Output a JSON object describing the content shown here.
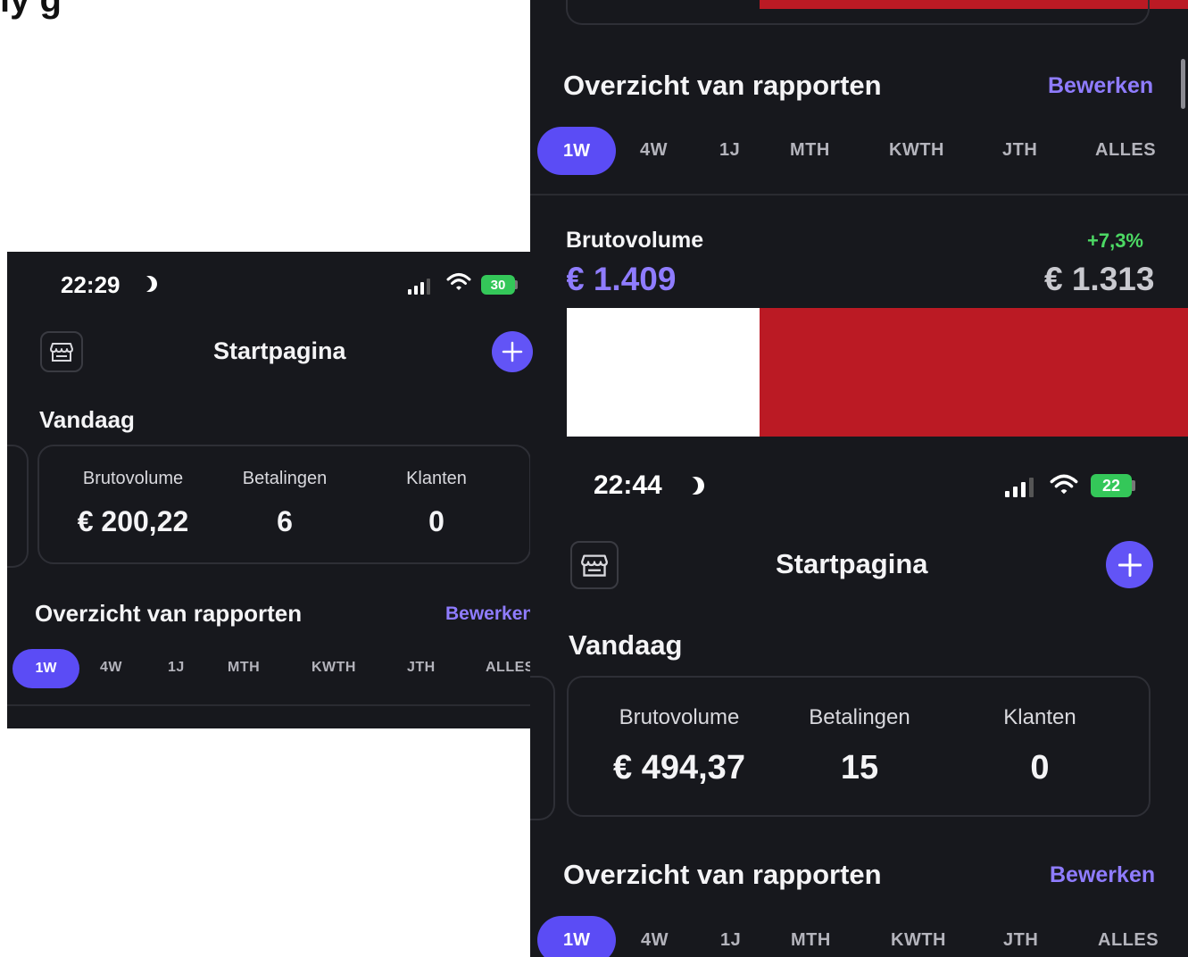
{
  "caption": "ly g",
  "top_panel": {
    "section_title": "Overzicht van rapporten",
    "edit_label": "Bewerken",
    "tabs": [
      "1W",
      "4W",
      "1J",
      "MTH",
      "KWTH",
      "JTH",
      "ALLES"
    ],
    "metric": {
      "label": "Brutovolume",
      "change": "+7,3%",
      "current": "€ 1.409",
      "previous": "€ 1.313"
    }
  },
  "left_phone": {
    "time": "22:29",
    "battery": "30",
    "header_title": "Startpagina",
    "today_title": "Vandaag",
    "stats": [
      {
        "label": "Brutovolume",
        "value": "€ 200,22"
      },
      {
        "label": "Betalingen",
        "value": "6"
      },
      {
        "label": "Klanten",
        "value": "0"
      }
    ],
    "section_title": "Overzicht van rapporten",
    "edit_label": "Bewerken",
    "tabs": [
      "1W",
      "4W",
      "1J",
      "MTH",
      "KWTH",
      "JTH",
      "ALLES"
    ]
  },
  "right_phone": {
    "time": "22:44",
    "battery": "22",
    "header_title": "Startpagina",
    "today_title": "Vandaag",
    "stats": [
      {
        "label": "Brutovolume",
        "value": "€ 494,37"
      },
      {
        "label": "Betalingen",
        "value": "15"
      },
      {
        "label": "Klanten",
        "value": "0"
      }
    ],
    "section_title": "Overzicht van rapporten",
    "edit_label": "Bewerken",
    "tabs": [
      "1W",
      "4W",
      "1J",
      "MTH",
      "KWTH",
      "JTH",
      "ALLES"
    ]
  },
  "colors": {
    "background": "#17181d",
    "accent": "#5b4cf5",
    "link": "#8f7cff",
    "positive": "#4cd964",
    "battery": "#34c759",
    "red_block": "#bb1a24"
  }
}
